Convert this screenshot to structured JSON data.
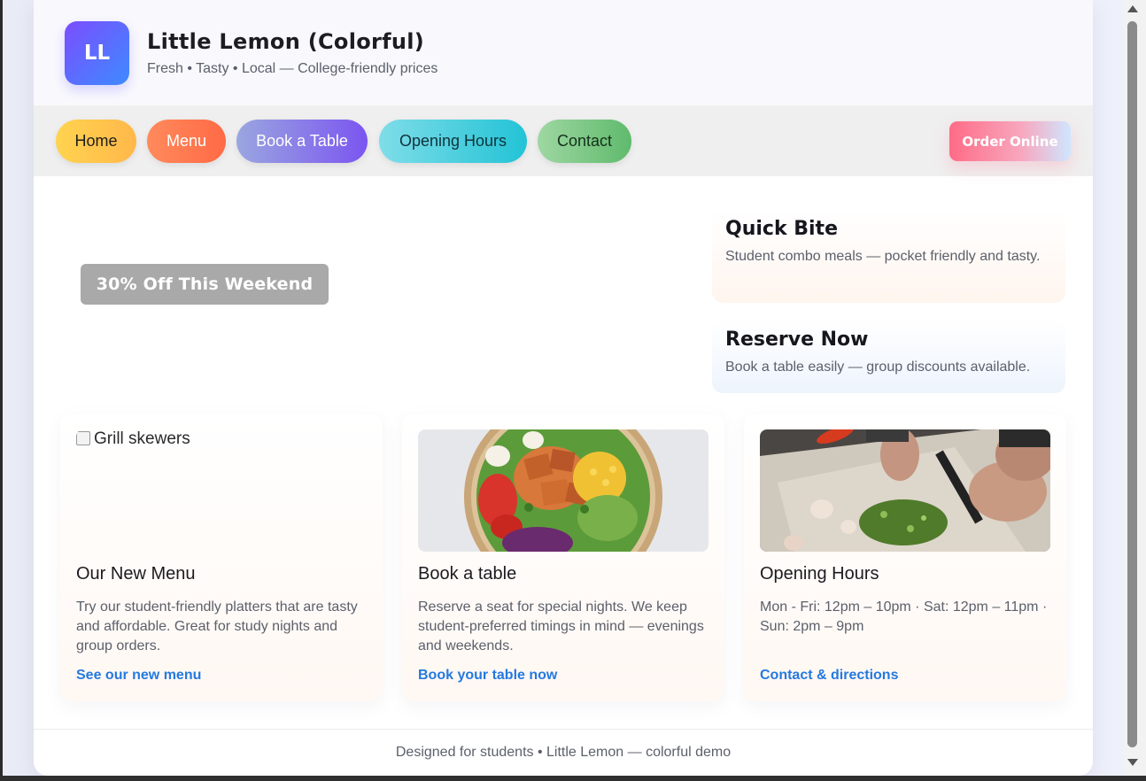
{
  "header": {
    "logo_text": "LL",
    "title": "Little Lemon (Colorful)",
    "tagline": "Fresh • Tasty • Local — College-friendly prices"
  },
  "nav": {
    "items": [
      {
        "label": "Home"
      },
      {
        "label": "Menu"
      },
      {
        "label": "Book a Table"
      },
      {
        "label": "Opening Hours"
      },
      {
        "label": "Contact"
      }
    ],
    "order_button": "Order Online"
  },
  "hero": {
    "promo": "30% Off This Weekend"
  },
  "side_cards": [
    {
      "title": "Quick Bite",
      "text": "Student combo meals — pocket friendly and tasty."
    },
    {
      "title": "Reserve Now",
      "text": "Book a table easily — group discounts available."
    }
  ],
  "cards": [
    {
      "image_alt": "Grill skewers",
      "title": "Our New Menu",
      "text": "Try our student-friendly platters that are tasty and affordable. Great for study nights and group orders.",
      "link": "See our new menu"
    },
    {
      "image_alt": "",
      "title": "Book a table",
      "text": "Reserve a seat for special nights. We keep student-preferred timings in mind — evenings and weekends.",
      "link": "Book your table now"
    },
    {
      "image_alt": "",
      "title": "Opening Hours",
      "text": "Mon - Fri: 12pm – 10pm · Sat: 12pm – 11pm · Sun: 2pm – 9pm",
      "link": "Contact & directions"
    }
  ],
  "footer": {
    "text": "Designed for students • Little Lemon — colorful demo"
  },
  "colors": {
    "accent_link": "#2479e0",
    "logo_gradient_start": "#7b4dff",
    "logo_gradient_end": "#3d8bff"
  }
}
